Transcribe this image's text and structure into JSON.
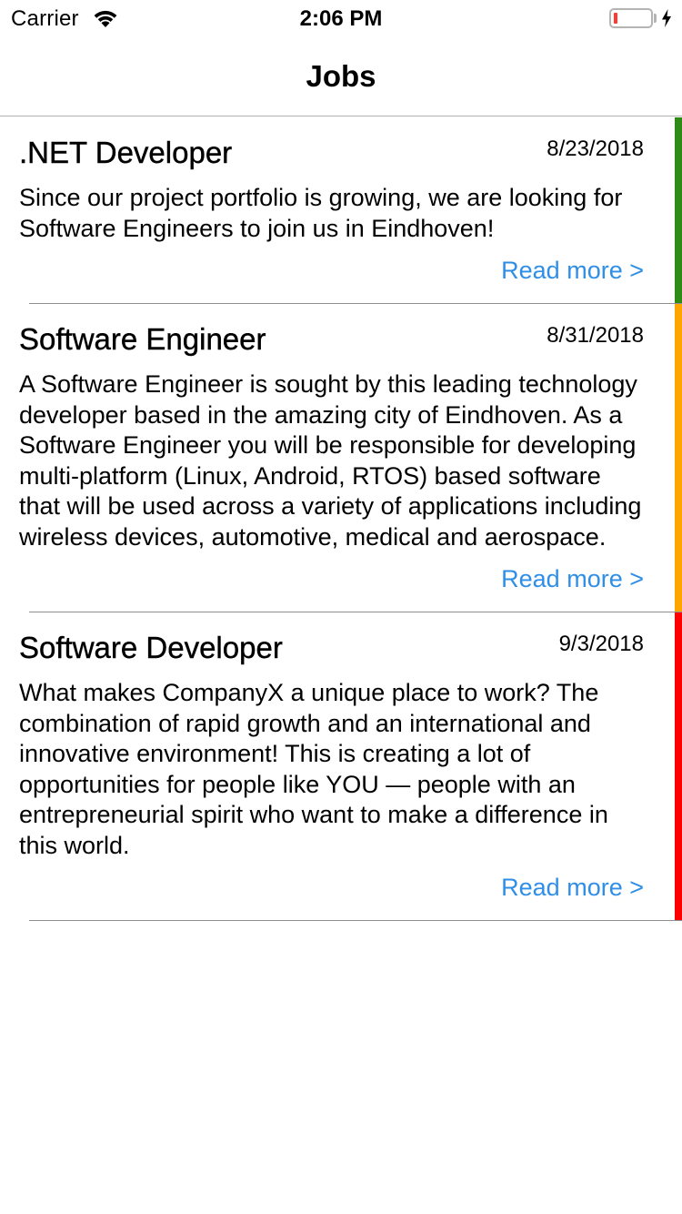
{
  "status_bar": {
    "carrier": "Carrier",
    "time": "2:06 PM"
  },
  "nav": {
    "title": "Jobs"
  },
  "colors": {
    "link": "#2f8ee6",
    "accent_green": "#2e8b16",
    "accent_orange": "#ffa500",
    "accent_red": "#ff0000"
  },
  "jobs": [
    {
      "title": ".NET Developer",
      "date": "8/23/2018",
      "description": "Since our project portfolio is growing, we are looking for Software Engineers to join us in Eindhoven!",
      "read_more": "Read more >",
      "accent": "#2e8b16"
    },
    {
      "title": "Software Engineer",
      "date": "8/31/2018",
      "description": "A Software Engineer is sought by this leading technology developer based in the amazing city of Eindhoven. As a Software Engineer you will be responsible for developing multi-platform (Linux, Android, RTOS) based software that will be used across a variety of applications including wireless devices, automotive, medical and aerospace.",
      "read_more": "Read more >",
      "accent": "#ffa500"
    },
    {
      "title": "Software Developer",
      "date": "9/3/2018",
      "description": "What makes CompanyX a unique place to work? The combination of rapid growth and an international and innovative environment! This is creating a lot of opportunities for people like YOU — people with an entrepreneurial spirit who want to make a difference in this world.",
      "read_more": "Read more >",
      "accent": "#ff0000"
    }
  ]
}
